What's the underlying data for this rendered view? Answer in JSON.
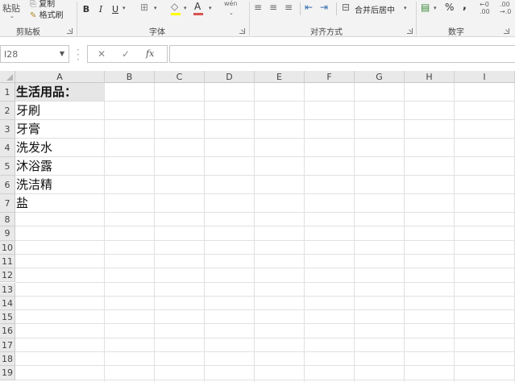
{
  "ribbon": {
    "clipboard": {
      "paste": "粘贴",
      "copy": "复制",
      "format_painter": "格式刷",
      "label": "剪贴板"
    },
    "font": {
      "bold": "B",
      "italic": "I",
      "underline": "U",
      "font_color": "A",
      "label": "字体"
    },
    "alignment": {
      "merge_center": "合并后居中",
      "label": "对齐方式"
    },
    "number": {
      "percent": "%",
      "comma": ",",
      "label": "数字"
    }
  },
  "formula_bar": {
    "name_box": "I28",
    "fx": "fx",
    "formula": ""
  },
  "sheet": {
    "columns": [
      "A",
      "B",
      "C",
      "D",
      "E",
      "F",
      "G",
      "H",
      "I"
    ],
    "rows": [
      "1",
      "2",
      "3",
      "4",
      "5",
      "6",
      "7",
      "8",
      "9",
      "10",
      "11",
      "12",
      "13",
      "14",
      "15",
      "16",
      "17",
      "18",
      "19"
    ],
    "cells_a": [
      "生活用品：",
      "牙刷",
      "牙膏",
      "洗发水",
      "沐浴露",
      "洗洁精",
      "盐"
    ]
  }
}
